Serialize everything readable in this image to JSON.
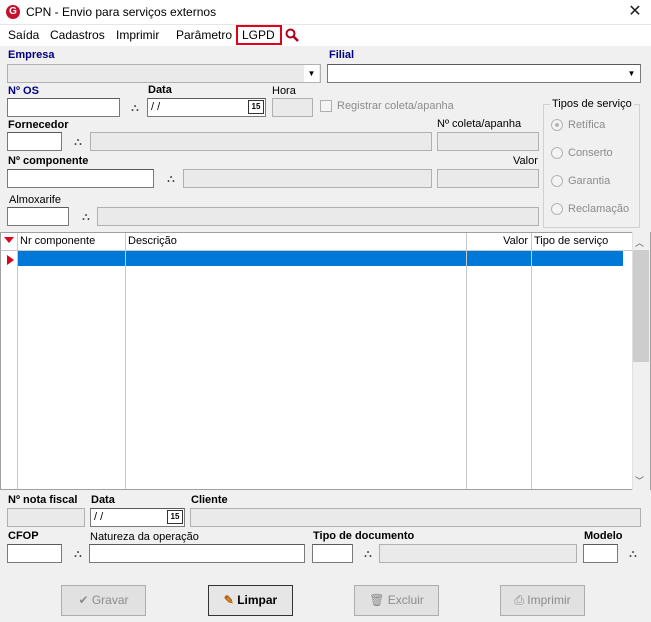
{
  "window": {
    "title": "CPN - Envio para serviços externos",
    "app_icon_letter": "G",
    "close_glyph": "✕"
  },
  "menu": {
    "items": [
      "Saída",
      "Cadastros",
      "Imprimir",
      "Parâmetro",
      "LGPD"
    ]
  },
  "form": {
    "empresa_label": "Empresa",
    "filial_label": "Filial",
    "nos_label": "Nº  OS",
    "data_label": "Data",
    "data_value": " / /",
    "hora_label": "Hora",
    "registrar_label": "Registrar coleta/apanha",
    "fornecedor_label": "Fornecedor",
    "ncoleta_label": "Nº coleta/apanha",
    "ncomponente_label": "Nº  componente",
    "valor_label": "Valor",
    "almoxarife_label": "Almoxarife",
    "cal_label": "15"
  },
  "tipos_servico": {
    "title": "Tipos de serviço",
    "options": [
      "Retífica",
      "Conserto",
      "Garantia",
      "Reclamação"
    ],
    "selected": 0
  },
  "grid": {
    "columns": [
      "Nr componente",
      "Descrição",
      "Valor",
      "Tipo de serviço"
    ]
  },
  "footer": {
    "nota_label": "Nº nota fiscal",
    "data_label": "Data",
    "data_value": " / /",
    "cliente_label": "Cliente",
    "cfop_label": "CFOP",
    "natureza_label": "Natureza da operação",
    "tipo_doc_label": "Tipo de documento",
    "modelo_label": "Modelo"
  },
  "buttons": {
    "gravar": "Gravar",
    "limpar": "Limpar",
    "excluir": "Excluir",
    "imprimir": "Imprimir"
  },
  "colors": {
    "selection": "#0078d7",
    "label_blue": "#000080",
    "lgpd_border": "#e1001a",
    "row_marker": "#e1001a"
  }
}
